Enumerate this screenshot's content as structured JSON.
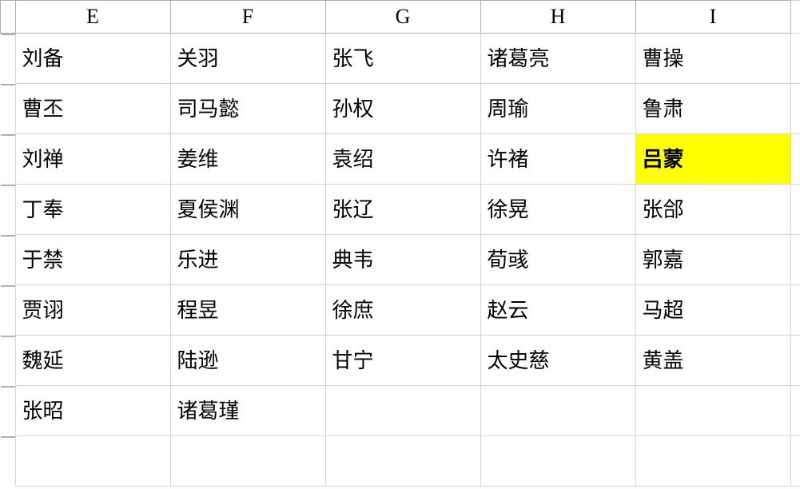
{
  "columns": [
    "E",
    "F",
    "G",
    "H",
    "I"
  ],
  "rows": [
    {
      "cells": [
        "刘备",
        "关羽",
        "张飞",
        "诸葛亮",
        "曹操"
      ],
      "highlight": null
    },
    {
      "cells": [
        "曹丕",
        "司马懿",
        "孙权",
        "周瑜",
        "鲁肃"
      ],
      "highlight": null
    },
    {
      "cells": [
        "刘禅",
        "姜维",
        "袁绍",
        "许褚",
        "吕蒙"
      ],
      "highlight": 4
    },
    {
      "cells": [
        "丁奉",
        "夏侯渊",
        "张辽",
        "徐晃",
        "张郃"
      ],
      "highlight": null
    },
    {
      "cells": [
        "于禁",
        "乐进",
        "典韦",
        "荀彧",
        "郭嘉"
      ],
      "highlight": null
    },
    {
      "cells": [
        "贾诩",
        "程昱",
        "徐庶",
        "赵云",
        "马超"
      ],
      "highlight": null
    },
    {
      "cells": [
        "魏延",
        "陆逊",
        "甘宁",
        "太史慈",
        "黄盖"
      ],
      "highlight": null
    },
    {
      "cells": [
        "张昭",
        "诸葛瑾",
        "",
        "",
        ""
      ],
      "highlight": null
    },
    {
      "cells": [
        "",
        "",
        "",
        "",
        ""
      ],
      "highlight": null
    }
  ]
}
